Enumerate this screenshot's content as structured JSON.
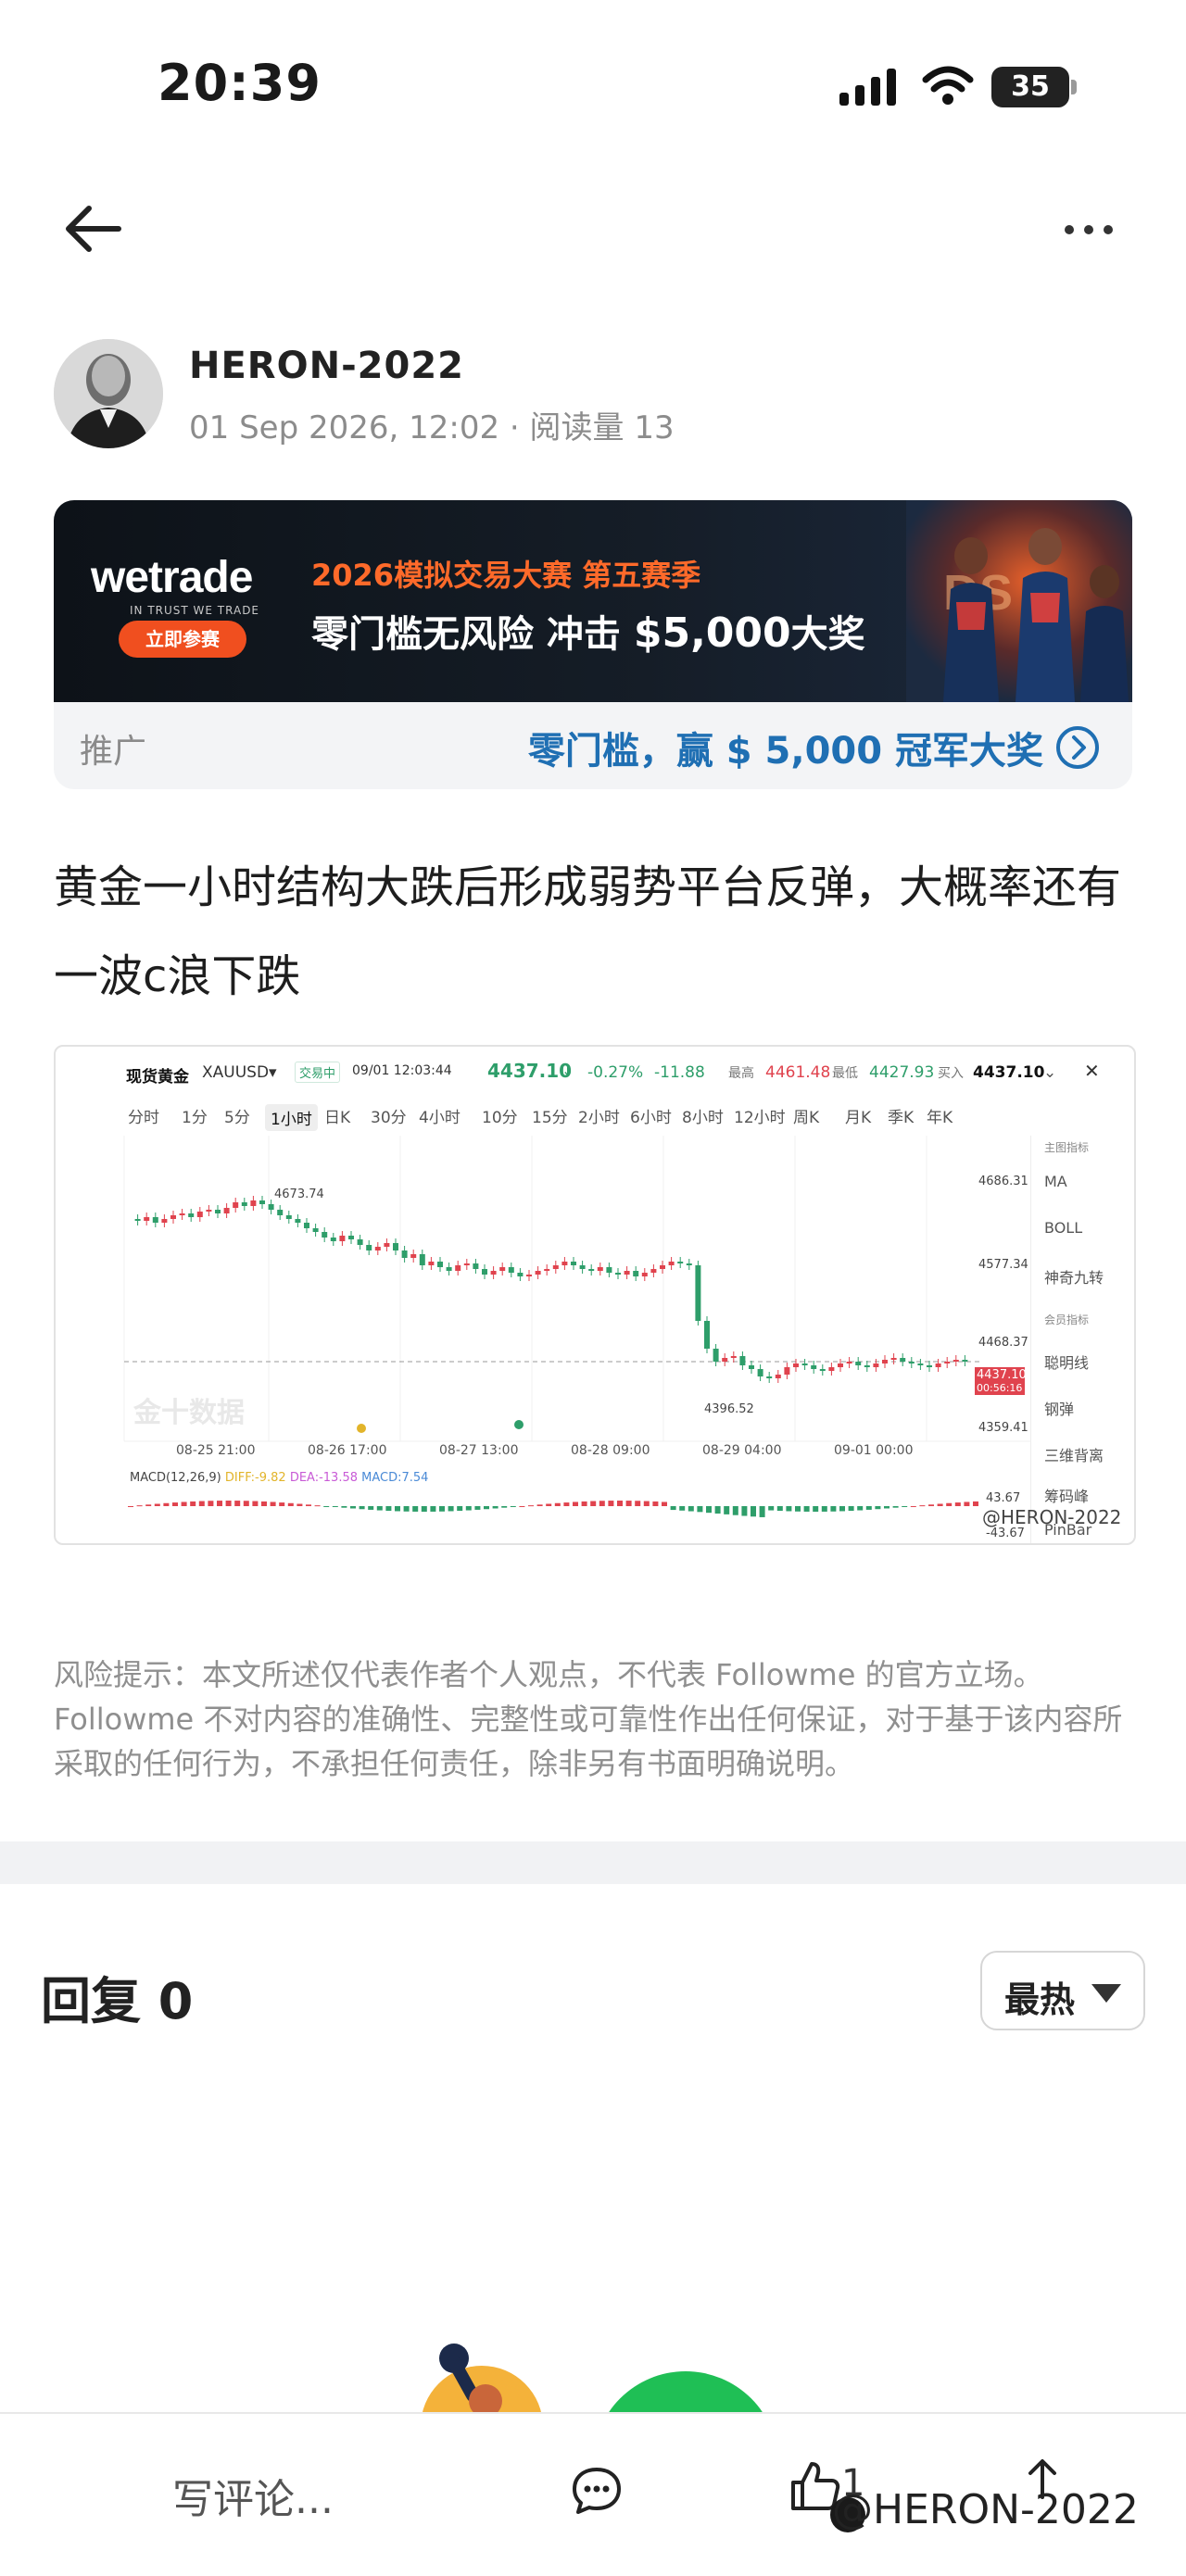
{
  "status_bar": {
    "time": "20:39",
    "battery": "35"
  },
  "author": {
    "name": "HERON-2022",
    "meta": "01 Sep 2026, 12:02 · 阅读量 13"
  },
  "ad": {
    "logo": "wetrade",
    "tagline": "IN TRUST WE TRADE",
    "cta": "立即参赛",
    "headline": "2026模拟交易大赛 第五赛季",
    "subline_prefix": "零门槛无风险 冲击 ",
    "subline_amount": "$5,000",
    "subline_suffix": "大奖",
    "label": "推广",
    "link": "零门槛，赢 $ 5,000 冠军大奖"
  },
  "post": {
    "body": "黄金一小时结构大跌后形成弱势平台反弹，大概率还有一波c浪下跌"
  },
  "chart_image": {
    "symbol": "现货黄金",
    "code": "XAUUSD",
    "trading_status": "交易中",
    "timestamp": "09/01 12:03:44",
    "price": "4437.10",
    "change_pct": "-0.27%",
    "change": "-11.88",
    "high_label": "最高",
    "high": "4461.48",
    "low_label": "最低",
    "low": "4427.93",
    "buy_label": "买入",
    "buy": "4437.10",
    "timeframes": [
      "分时",
      "1分",
      "5分",
      "1小时",
      "日K",
      "30分",
      "4小时",
      "10分",
      "15分",
      "2小时",
      "6小时",
      "8小时",
      "12小时",
      "周K",
      "月K",
      "季K",
      "年K"
    ],
    "active_timeframe": "1小时",
    "side_panel": [
      "主图指标",
      "MA",
      "BOLL",
      "神奇九转",
      "会员指标",
      "聪明线",
      "钢弹",
      "三维背离",
      "筹码峰",
      "PinBar"
    ],
    "price_levels": [
      "4686.31",
      "4577.34",
      "4468.37",
      "4359.41"
    ],
    "high_marker": "4673.74",
    "low_marker": "4396.52",
    "current_tag_top": "4437.10",
    "current_tag_bottom": "00:56:16",
    "dates": [
      "08-25 21:00",
      "08-26 17:00",
      "08-27 13:00",
      "08-28 09:00",
      "08-29 04:00",
      "09-01 00:00"
    ],
    "macd_label": "MACD(12,26,9)",
    "macd_diff": "DIFF:-9.82",
    "macd_dea": "DEA:-13.58",
    "macd_value": "MACD:7.54",
    "macd_top": "43.67",
    "macd_bottom": "-43.67",
    "source_watermark": "金十数据",
    "author_watermark": "@HERON-2022"
  },
  "disclaimer": "风险提示：本文所述仅代表作者个人观点，不代表 Followme 的官方立场。Followme 不对内容的准确性、完整性或可靠性作出任何保证，对于基于该内容所采取的任何行为，不承担任何责任，除非另有书面明确说明。",
  "replies": {
    "title": "回复 0",
    "sort": "最热"
  },
  "bottom_bar": {
    "comment_placeholder": "写评论...",
    "like_count": "1",
    "watermark": "@HERON-2022"
  },
  "colors": {
    "up": "#2e9e6a",
    "down": "#e0434e",
    "link": "#1f6fb3",
    "accent": "#f04f1f"
  },
  "icons": [
    "back-arrow-icon",
    "more-icon",
    "comment-icon",
    "like-icon",
    "share-icon",
    "chevron-right-icon"
  ]
}
